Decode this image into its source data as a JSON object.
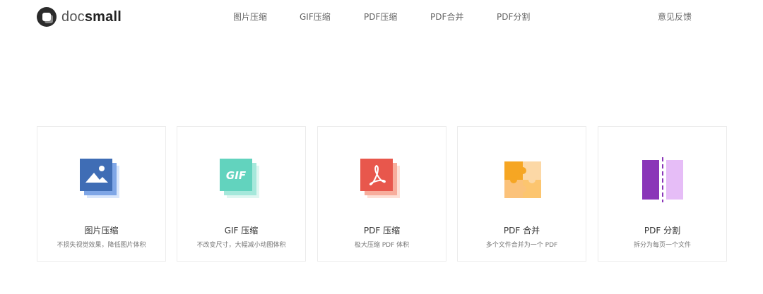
{
  "brand": {
    "prefix": "doc",
    "suffix": "small"
  },
  "nav": {
    "items": [
      "图片压缩",
      "GIF压缩",
      "PDF压缩",
      "PDF合并",
      "PDF分割"
    ],
    "feedback": "意见反馈"
  },
  "cards": [
    {
      "title": "图片压缩",
      "desc": "不损失视觉效果，降低图片体积",
      "icon": "image-stack-icon",
      "color": "#3f6db5"
    },
    {
      "title": "GIF 压缩",
      "desc": "不改变尺寸，大幅减小动图体积",
      "icon": "gif-stack-icon",
      "color": "#62d3be",
      "badge": "GIF"
    },
    {
      "title": "PDF 压缩",
      "desc": "极大压缩 PDF 体积",
      "icon": "pdf-stack-icon",
      "color": "#e8574c"
    },
    {
      "title": "PDF 合并",
      "desc": "多个文件合并为一个 PDF",
      "icon": "puzzle-merge-icon",
      "color": "#f6a623"
    },
    {
      "title": "PDF 分割",
      "desc": "拆分为每页一个文件",
      "icon": "split-page-icon",
      "color": "#8a35b8"
    }
  ]
}
